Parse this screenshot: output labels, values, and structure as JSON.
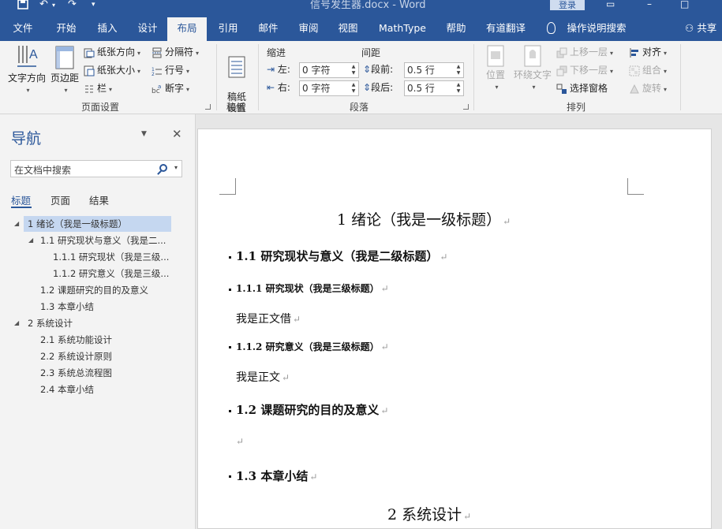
{
  "titlebar": {
    "doc_title": "信号发生器.docx - Word",
    "login_label": "登录"
  },
  "tabs": [
    {
      "label": "文件"
    },
    {
      "label": "开始"
    },
    {
      "label": "插入"
    },
    {
      "label": "设计"
    },
    {
      "label": "布局",
      "active": true
    },
    {
      "label": "引用"
    },
    {
      "label": "邮件"
    },
    {
      "label": "审阅"
    },
    {
      "label": "视图"
    },
    {
      "label": "MathType"
    },
    {
      "label": "帮助"
    },
    {
      "label": "有道翻译"
    },
    {
      "label": "操作说明搜索"
    }
  ],
  "share_label": "共享",
  "ribbon": {
    "page_setup": {
      "label": "页面设置",
      "text_direction": "文字方向",
      "margins": "页边距",
      "orientation": "纸张方向",
      "size": "纸张大小",
      "columns": "栏",
      "breaks": "分隔符",
      "line_numbers": "行号",
      "hyphenation": "断字"
    },
    "manuscript": {
      "label": "稿纸",
      "button": "稿纸\n设置"
    },
    "paragraph": {
      "label": "段落",
      "indent_head": "缩进",
      "spacing_head": "间距",
      "left_label": "左:",
      "right_label": "右:",
      "before_label": "段前:",
      "after_label": "段后:",
      "left_value": "0 字符",
      "right_value": "0 字符",
      "before_value": "0.5 行",
      "after_value": "0.5 行"
    },
    "arrange": {
      "label": "排列",
      "position": "位置",
      "wrap_text": "环绕文字",
      "bring_forward": "上移一层",
      "send_backward": "下移一层",
      "selection_pane": "选择窗格",
      "align": "对齐",
      "group": "组合",
      "rotate": "旋转"
    }
  },
  "nav": {
    "title": "导航",
    "search_placeholder": "在文档中搜索",
    "tabs": [
      "标题",
      "页面",
      "结果"
    ],
    "items": [
      {
        "text": "1 绪论（我是一级标题）",
        "selected": true,
        "expanded": true
      },
      {
        "text": "1.1 研究现状与意义（我是二...",
        "expanded": true
      },
      {
        "text": "1.1.1 研究现状（我是三级..."
      },
      {
        "text": "1.1.2 研究意义（我是三级..."
      },
      {
        "text": "1.2 课题研究的目的及意义"
      },
      {
        "text": "1.3 本章小结"
      },
      {
        "text": "2 系统设计",
        "expanded": true
      },
      {
        "text": "2.1 系统功能设计"
      },
      {
        "text": "2.2 系统设计原则"
      },
      {
        "text": "2.3 系统总流程图"
      },
      {
        "text": "2.4 本章小结"
      }
    ]
  },
  "document": {
    "h1_1": "1   绪论（我是一级标题）",
    "h2_1": "1.1 研究现状与意义（我是二级标题）",
    "h3_1": "1.1.1 研究现状（我是三级标题）",
    "body_1": "我是正文借",
    "h3_2": "1.1.2 研究意义（我是三级标题）",
    "body_2": "我是正文",
    "h2_2": "1.2 课题研究的目的及意义",
    "h2_3": "1.3 本章小结",
    "h1_2": "2   系统设计",
    "para_mark": "↵"
  }
}
